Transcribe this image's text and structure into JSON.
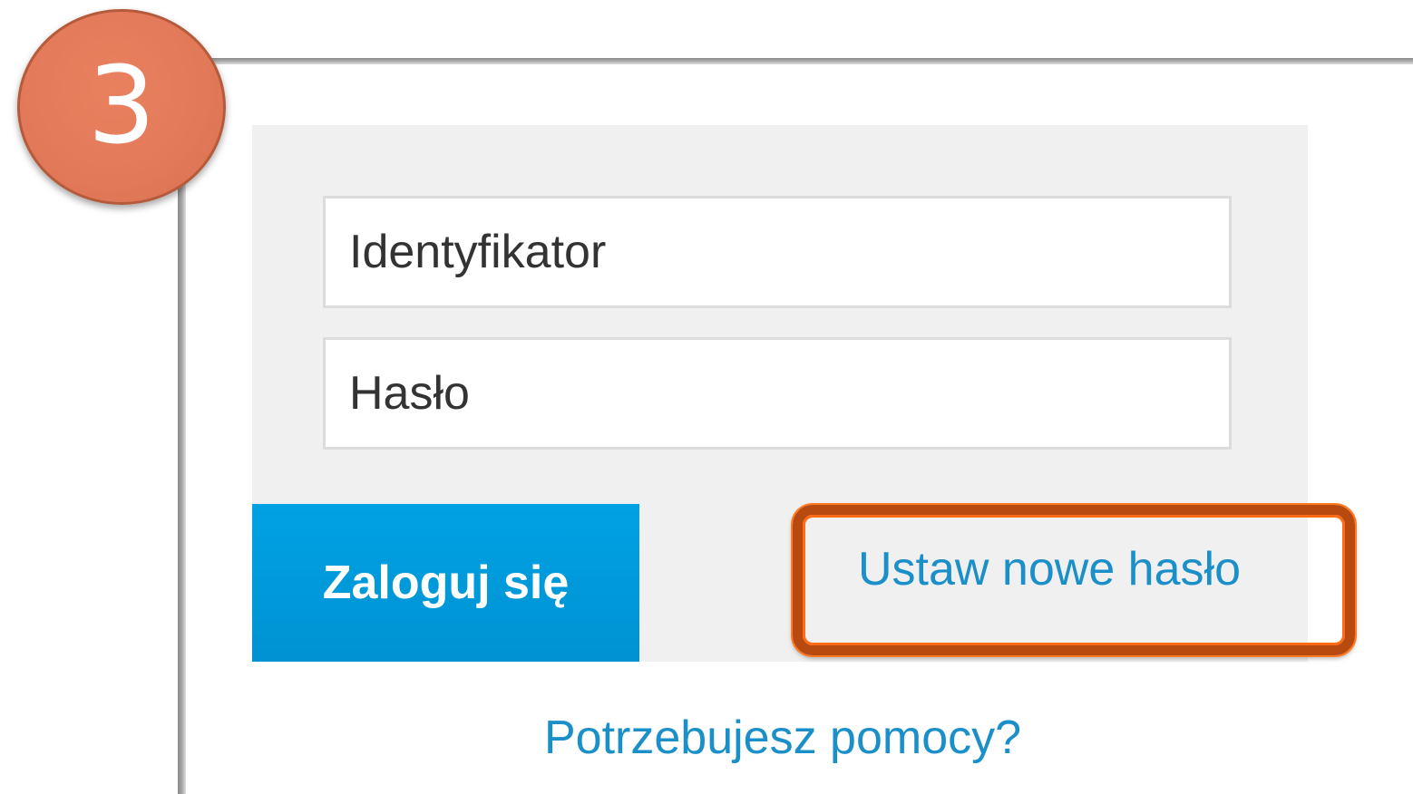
{
  "annotation": {
    "step_number": "3",
    "badge_color": "#e27a5a",
    "highlight_color": "#d4551a"
  },
  "login": {
    "identifier_placeholder": "Identyfikator",
    "password_placeholder": "Hasło",
    "login_button_label": "Zaloguj się",
    "reset_password_link": "Ustaw nowe hasło",
    "help_link": "Potrzebujesz pomocy?",
    "accent_color": "#009bdd"
  }
}
